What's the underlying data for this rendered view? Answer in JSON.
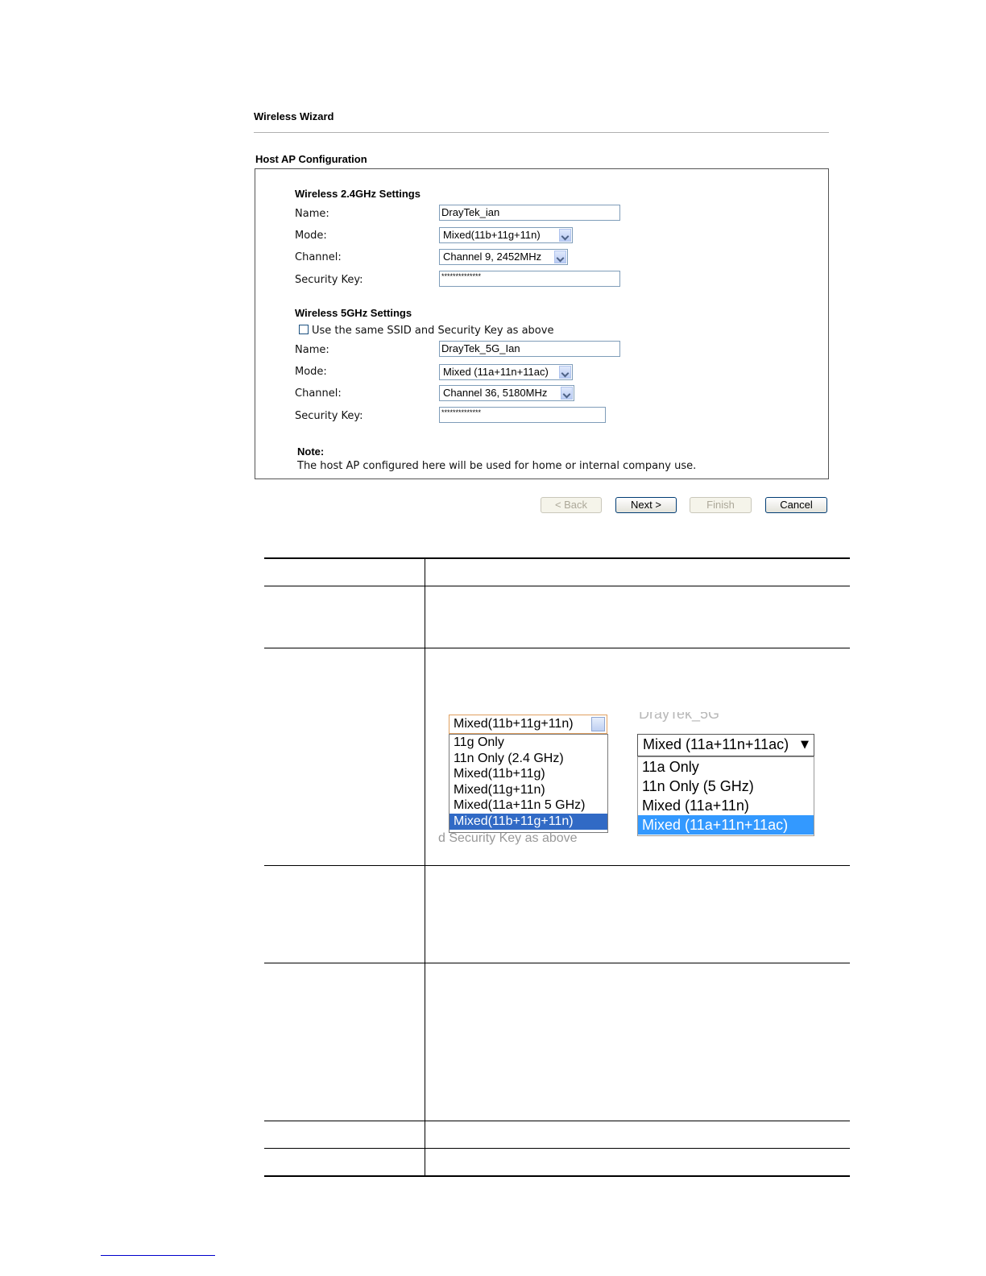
{
  "wizard": {
    "title": "Wireless Wizard",
    "section_title": "Host AP Configuration"
  },
  "band24": {
    "heading": "Wireless 2.4GHz Settings",
    "name_label": "Name:",
    "name_value": "DrayTek_ian",
    "mode_label": "Mode:",
    "mode_value": "Mixed(11b+11g+11n)",
    "channel_label": "Channel:",
    "channel_value": "Channel 9, 2452MHz",
    "key_label": "Security Key:",
    "key_value": "**************"
  },
  "band5": {
    "heading": "Wireless 5GHz Settings",
    "same_checkbox_label": "Use the same SSID and Security Key as above",
    "same_checked": false,
    "name_label": "Name:",
    "name_value": "DrayTek_5G_Ian",
    "mode_label": "Mode:",
    "mode_value": "Mixed (11a+11n+11ac)",
    "channel_label": "Channel:",
    "channel_value": "Channel 36, 5180MHz",
    "key_label": "Security Key:",
    "key_value": "**************"
  },
  "note": {
    "label": "Note:",
    "text": "The host AP configured here will be used for home or internal company use."
  },
  "buttons": {
    "back": "< Back",
    "next": "Next >",
    "finish": "Finish",
    "cancel": "Cancel"
  },
  "dropdown24": {
    "selected": "Mixed(11b+11g+11n)",
    "options": [
      "11g Only",
      "11n Only (2.4 GHz)",
      "Mixed(11b+11g)",
      "Mixed(11g+11n)",
      "Mixed(11a+11n 5 GHz)",
      "Mixed(11b+11g+11n)"
    ],
    "highlighted_index": 5,
    "underlay_text": "d Security Key as above"
  },
  "dropdown5": {
    "underlay_text": "DrayTek_5G",
    "selected": "Mixed (11a+11n+11ac)",
    "options": [
      "11a Only",
      "11n Only (5 GHz)",
      "Mixed (11a+11n)",
      "Mixed (11a+11n+11ac)"
    ],
    "highlighted_index": 3
  },
  "colors": {
    "highlight_24": "#316ac5",
    "highlight_5": "#3399ff",
    "footer_link": "#0000cc"
  }
}
